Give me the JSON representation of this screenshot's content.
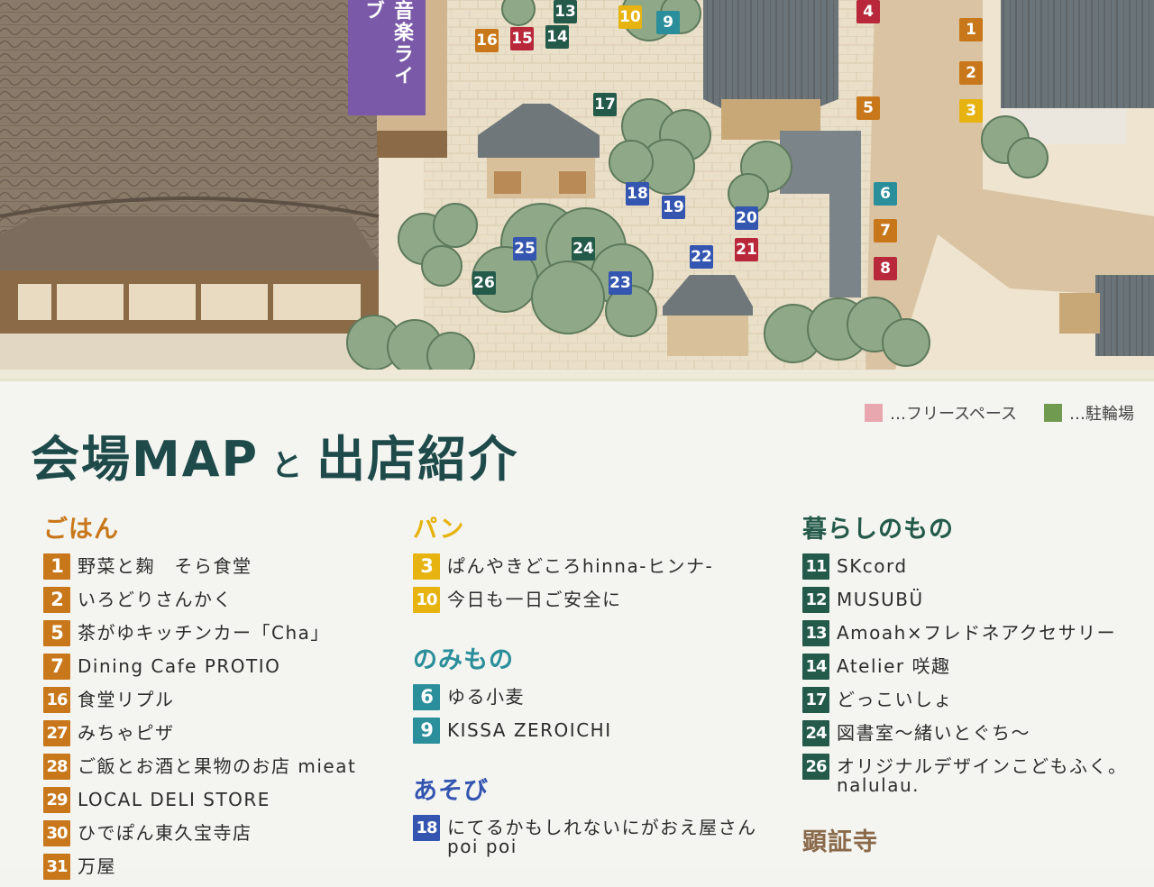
{
  "colors": {
    "orange": "#c8781a",
    "yellow": "#e6b310",
    "teal": "#2a8f9a",
    "darkgreen": "#245a4a",
    "red": "#b8283a",
    "blue": "#3455b0",
    "purple": "#7a5aa8",
    "temple_brown": "#8a6a4a"
  },
  "map": {
    "banner_label": "音楽ライブ",
    "markers": [
      "13",
      "10",
      "9",
      "4",
      "16",
      "15",
      "14",
      "1",
      "2",
      "17",
      "5",
      "3",
      "18",
      "19",
      "6",
      "20",
      "7",
      "25",
      "24",
      "21",
      "22",
      "8",
      "26",
      "23"
    ]
  },
  "legend": {
    "free_space": "…フリースペース",
    "bicycle_parking": "…駐輪場"
  },
  "title": {
    "main": "会場MAP",
    "connector": "と",
    "sub": "出店紹介"
  },
  "categories": {
    "gohan": {
      "heading": "ごはん",
      "items": [
        {
          "num": "1",
          "name": "野菜と麹　そら食堂"
        },
        {
          "num": "2",
          "name": "いろどりさんかく"
        },
        {
          "num": "5",
          "name": "茶がゆキッチンカー「Cha」"
        },
        {
          "num": "7",
          "name": "Dining Cafe PROTIO"
        },
        {
          "num": "16",
          "name": "食堂リプル"
        },
        {
          "num": "27",
          "name": "みちゃピザ"
        },
        {
          "num": "28",
          "name": "ご飯とお酒と果物のお店 mieat"
        },
        {
          "num": "29",
          "name": "LOCAL DELI STORE"
        },
        {
          "num": "30",
          "name": "ひでぽん東久宝寺店"
        },
        {
          "num": "31",
          "name": "万屋"
        }
      ]
    },
    "pan": {
      "heading": "パン",
      "items": [
        {
          "num": "3",
          "name": "ぱんやきどころhinna-ヒンナ-"
        },
        {
          "num": "10",
          "name": "今日も一日ご安全に"
        }
      ]
    },
    "nomimono": {
      "heading": "のみもの",
      "items": [
        {
          "num": "6",
          "name": "ゆる小麦"
        },
        {
          "num": "9",
          "name": "KISSA ZEROICHI"
        }
      ]
    },
    "asobi": {
      "heading": "あそび",
      "items": [
        {
          "num": "18",
          "name": "にてるかもしれないにがおえ屋さん",
          "name2": "poi poi"
        }
      ]
    },
    "kurashi": {
      "heading": "暮らしのもの",
      "items": [
        {
          "num": "11",
          "name": "SKcord"
        },
        {
          "num": "12",
          "name": "MUSUBÜ"
        },
        {
          "num": "13",
          "name": "Amoah×フレドネアクセサリー"
        },
        {
          "num": "14",
          "name": "Atelier 咲趣"
        },
        {
          "num": "17",
          "name": "どっこいしょ"
        },
        {
          "num": "24",
          "name": "図書室〜緒いとぐち〜"
        },
        {
          "num": "26",
          "name": "オリジナルデザインこどもふく。",
          "name2": "nalulau."
        }
      ]
    },
    "kenshoji": {
      "heading": "顕証寺"
    }
  }
}
